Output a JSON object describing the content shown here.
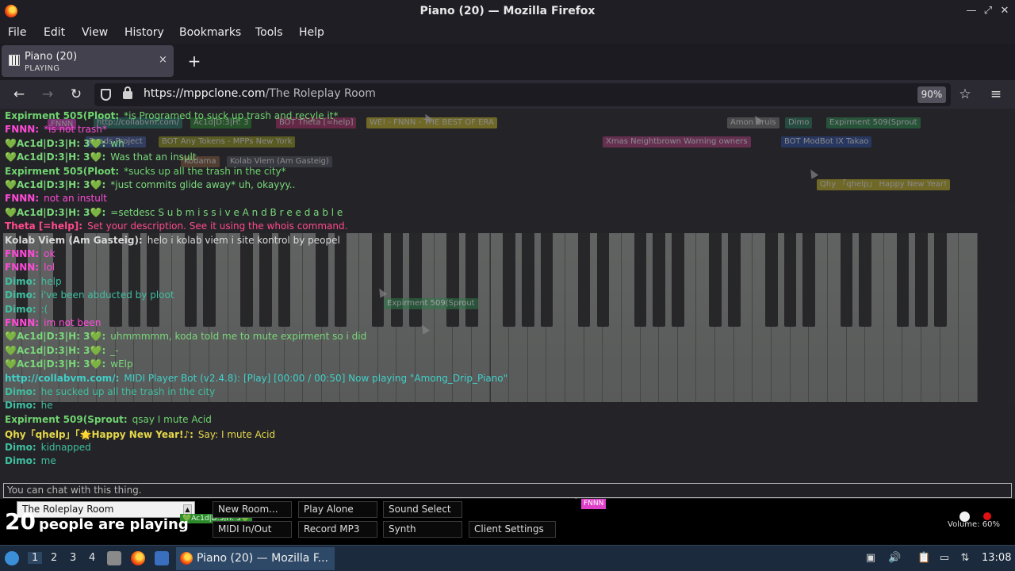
{
  "window": {
    "title": "Piano (20) — Mozilla Firefox"
  },
  "menu": [
    "File",
    "Edit",
    "View",
    "History",
    "Bookmarks",
    "Tools",
    "Help"
  ],
  "tab": {
    "title": "Piano (20)",
    "subtitle": "PLAYING",
    "close": "×",
    "new": "+"
  },
  "nav": {
    "url_host": "https://mppclone.com",
    "url_path": "/The Roleplay Room",
    "zoom": "90%"
  },
  "tags": [
    {
      "label": "FNNN",
      "color": "#e040c8"
    },
    {
      "label": "http://collabvm.com/",
      "color": "#2b7d6e"
    },
    {
      "label": "Ac1d|D:3|H: 3",
      "color": "#2c8a2c"
    },
    {
      "label": "BOT  Theta [=help]",
      "color": "#b0306a"
    },
    {
      "label": "WE!  - FNNN  - THE BEST OF ERA",
      "color": "#c9b825"
    },
    {
      "label": "Amon  Bruis",
      "color": "#7a7a7a"
    },
    {
      "label": "Dimo",
      "color": "#2b7d5e"
    },
    {
      "label": "Expirment 509(Sprout",
      "color": "#2f8a50"
    },
    {
      "label": "Roads Project",
      "color": "#4660a0"
    },
    {
      "label": "BOT  Any Tokens - MPPs  New York",
      "color": "#9a9a20"
    },
    {
      "label": "Kodama",
      "color": "#8a6040"
    },
    {
      "label": "Kolab Viem (Am Gasteig)",
      "color": "#555560"
    },
    {
      "label": "Xmas Neightbrown Warning owners",
      "color": "#b04080"
    },
    {
      "label": "BOT  ModBot  IX  Takao",
      "color": "#3050a0"
    },
    {
      "label": "Expirment 509(Sprout",
      "color": "#2f8a50"
    },
    {
      "label": "Qhy 「qhelp」 Happy New Year!",
      "color": "#c9b825"
    }
  ],
  "chat": [
    {
      "who": "Expirment 505(Ploot:",
      "msg": "*is Programed to suck up trash and recyle it*",
      "color": "#6fd36f"
    },
    {
      "who": "FNNN:",
      "msg": "*is not trash*",
      "color": "#ff4ad8"
    },
    {
      "who": "💚Ac1d|D:3|H: 3💚:",
      "msg": "wh",
      "color": "#7ad87a"
    },
    {
      "who": "💚Ac1d|D:3|H: 3💚:",
      "msg": "Was that an insult",
      "color": "#7ad87a"
    },
    {
      "who": "Expirment 505(Ploot:",
      "msg": "*sucks up all the trash in the city*",
      "color": "#6fd36f"
    },
    {
      "who": "💚Ac1d|D:3|H: 3💚:",
      "msg": "*just commits glide away* uh, okayyy..",
      "color": "#7ad87a"
    },
    {
      "who": "FNNN:",
      "msg": "not an instult",
      "color": "#ff4ad8"
    },
    {
      "who": "💚Ac1d|D:3|H: 3💚:",
      "msg": "=setdesc S u b m i s s i v e A n d B r e e d a b l e",
      "color": "#7ad87a"
    },
    {
      "who": "Theta [=help]:",
      "msg": "Set your description. See it using the whois command.",
      "color": "#ff4a8a"
    },
    {
      "who": "Kolab Viem (Am Gasteig):",
      "msg": "helo i kolab viem i site kontrol by peopel",
      "color": "#dadada"
    },
    {
      "who": "FNNN:",
      "msg": "ok",
      "color": "#ff4ad8"
    },
    {
      "who": "FNNN:",
      "msg": "lol",
      "color": "#ff4ad8"
    },
    {
      "who": "Dimo:",
      "msg": "help",
      "color": "#3fbfa0"
    },
    {
      "who": "Dimo:",
      "msg": "i've been abducted by ploot",
      "color": "#3fbfa0"
    },
    {
      "who": "Dimo:",
      "msg": ":(",
      "color": "#3fbfa0"
    },
    {
      "who": "FNNN:",
      "msg": "im not been",
      "color": "#ff4ad8"
    },
    {
      "who": "💚Ac1d|D:3|H: 3💚:",
      "msg": "uhmmmmm, koda told me to mute expirment so i did",
      "color": "#7ad87a"
    },
    {
      "who": "💚Ac1d|D:3|H: 3💚:",
      "msg": "_-",
      "color": "#7ad87a"
    },
    {
      "who": "💚Ac1d|D:3|H: 3💚:",
      "msg": "wElp",
      "color": "#7ad87a"
    },
    {
      "who": "http://collabvm.com/:",
      "msg": "MIDI Player Bot (v2.4.8): [Play] [00:00 / 00:50] Now playing \"Among_Drip_Piano\"",
      "color": "#3fd0c8"
    },
    {
      "who": "Dimo:",
      "msg": "he sucked up all the trash in the city",
      "color": "#3fbfa0"
    },
    {
      "who": "Dimo:",
      "msg": "he",
      "color": "#3fbfa0"
    },
    {
      "who": "Expirment 509(Sprout:",
      "msg": "qsay I mute Acid",
      "color": "#6fd36f"
    },
    {
      "who": "Qhy「qhelp」「🌟Happy New Year!♪:",
      "msg": "Say: I mute Acid",
      "color": "#e6d84a"
    },
    {
      "who": "Dimo:",
      "msg": "kidnapped",
      "color": "#3fbfa0"
    },
    {
      "who": "Dimo:",
      "msg": "me",
      "color": "#3fbfa0"
    }
  ],
  "chat_input": {
    "placeholder": "You can chat with this thing."
  },
  "bottom": {
    "room": "The Roleplay Room",
    "new_room": "New Room...",
    "play_alone": "Play Alone",
    "sound_select": "Sound Select",
    "midi": "MIDI In/Out",
    "record": "Record MP3",
    "synth": "Synth",
    "client_settings": "Client Settings",
    "count": "20",
    "count_text": "people are playing",
    "volume": "Volume: 60%",
    "fnnn_tag": "FNNN",
    "acid_tag": "💚Ac1d|D:3|H: 3💚"
  },
  "taskbar": {
    "workspaces": [
      "1",
      "2",
      "3",
      "4"
    ],
    "task": "Piano (20) — Mozilla F...",
    "clock": "13:08"
  }
}
